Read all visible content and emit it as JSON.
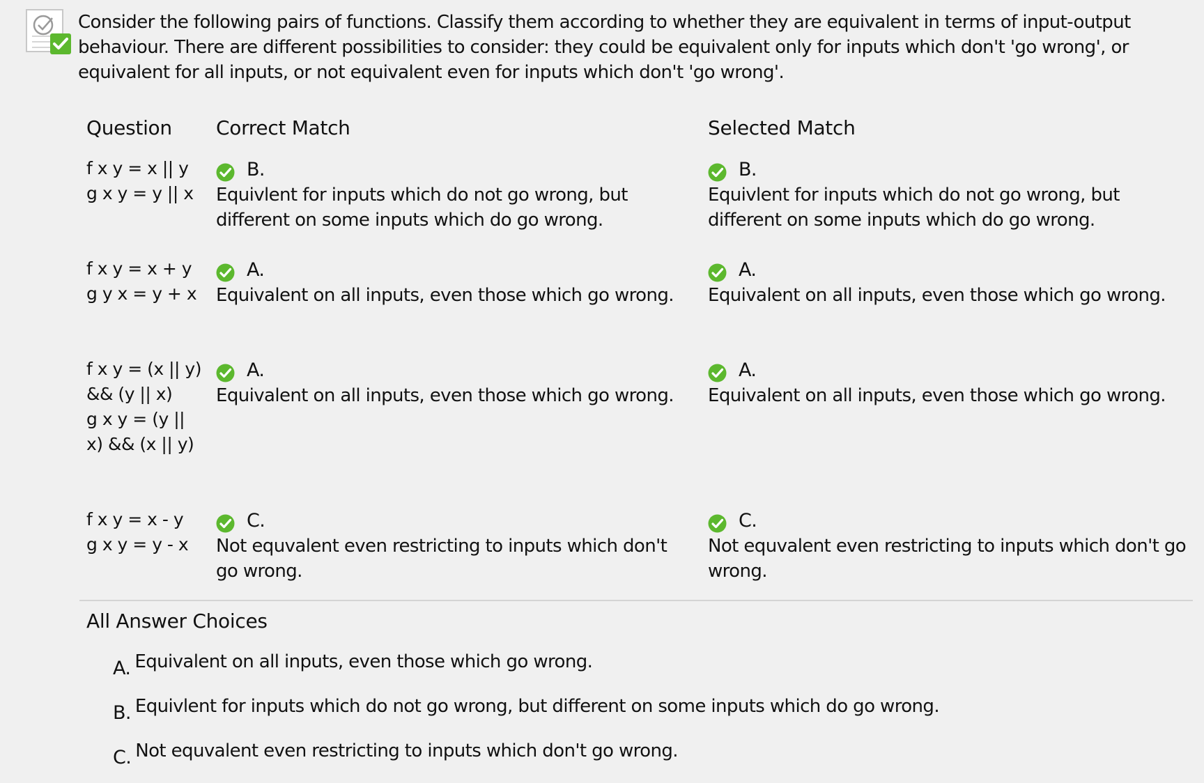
{
  "prompt": "Consider the following pairs of functions. Classify them according to whether they are equivalent in terms of input-output behaviour. There are different possibilities to consider: they could be equivalent only for inputs which don't 'go wrong', or equivalent for all inputs, or not equivalent even for inputs which don't 'go wrong'.",
  "headers": {
    "question": "Question",
    "correct": "Correct Match",
    "selected": "Selected Match"
  },
  "rows": [
    {
      "question_lines": [
        "f x y = x || y",
        "",
        "g x y = y || x"
      ],
      "correct_letter": "B.",
      "correct_text": "Equivlent for inputs which do not go wrong, but different on some inputs which do go wrong.",
      "selected_letter": "B.",
      "selected_text": "Equivlent for inputs which do not go wrong, but different on some inputs which do go wrong."
    },
    {
      "question_lines": [
        "f x y = x + y",
        "",
        "g y x = y + x"
      ],
      "correct_letter": "A.",
      "correct_text": "Equivalent on all inputs, even those which go wrong.",
      "selected_letter": "A.",
      "selected_text": "Equivalent on all inputs, even those which go wrong."
    },
    {
      "question_lines": [
        "f x y = (x || y)",
        "&& (y || x)",
        "",
        "g x y = (y ||",
        "x) && (x || y)"
      ],
      "correct_letter": "A.",
      "correct_text": "Equivalent on all inputs, even those which go wrong.",
      "selected_letter": "A.",
      "selected_text": "Equivalent on all inputs, even those which go wrong."
    },
    {
      "question_lines": [
        "f x y = x - y",
        "",
        "g x y = y - x"
      ],
      "correct_letter": "C.",
      "correct_text": "Not equvalent even restricting to inputs which don't go wrong.",
      "selected_letter": "C.",
      "selected_text": "Not equvalent even restricting to inputs which don't go wrong."
    }
  ],
  "all_choices": {
    "title": "All Answer Choices",
    "items": [
      {
        "letter": "A.",
        "text": "Equivalent on all inputs, even those which go wrong."
      },
      {
        "letter": "B.",
        "text": "Equivlent for inputs which do not go wrong, but different on some inputs which do go wrong."
      },
      {
        "letter": "C.",
        "text": "Not equvalent even restricting to inputs which don't go wrong."
      }
    ]
  },
  "colors": {
    "check_green": "#5cb82e",
    "background": "#f0f0f0"
  },
  "icons": {
    "question_status": "graded-correct-icon",
    "match_status": "correct-check-icon"
  }
}
